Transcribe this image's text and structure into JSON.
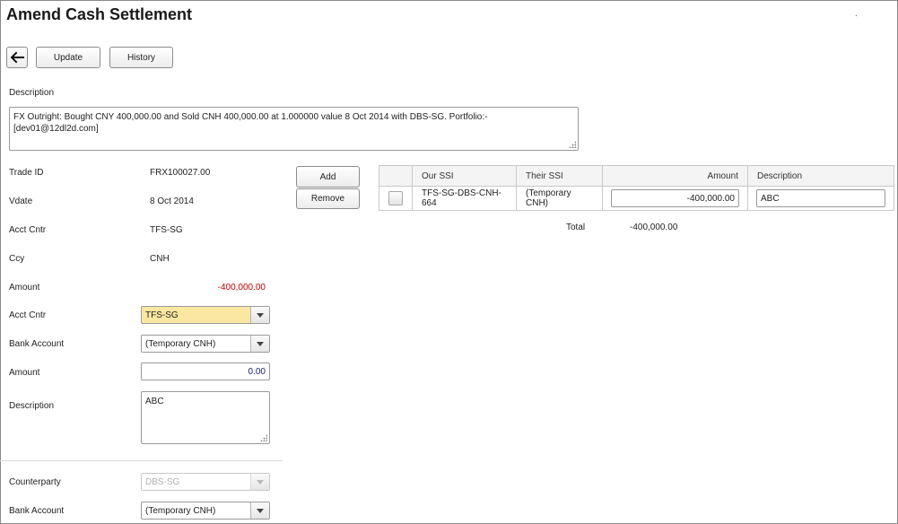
{
  "page": {
    "title": "Amend Cash Settlement",
    "corner_mark": "."
  },
  "toolbar": {
    "back_icon": "arrow-left-icon",
    "update_label": "Update",
    "history_label": "History"
  },
  "description": {
    "label": "Description",
    "value": "FX Outright: Bought CNY 400,000.00 and Sold CNH 400,000.00 at 1.000000 value 8 Oct 2014 with DBS-SG. Portfolio:- [dev01@12dl2d.com]"
  },
  "trade": {
    "trade_id_label": "Trade ID",
    "trade_id": "FRX100027.00",
    "vdate_label": "Vdate",
    "vdate": "8 Oct 2014",
    "acct_cntr_label": "Acct Cntr",
    "acct_cntr": "TFS-SG",
    "ccy_label": "Ccy",
    "ccy": "CNH",
    "amount_label": "Amount",
    "amount": "-400,000.00",
    "amount_color": "#c00000"
  },
  "form": {
    "acct_cntr_label": "Acct Cntr",
    "acct_cntr_value": "TFS-SG",
    "bank_account_label": "Bank Account",
    "bank_account_value": "(Temporary CNH)",
    "amount_label": "Amount",
    "amount_value": "0.00",
    "description_label": "Description",
    "description_value": "ABC",
    "highlight_color": "#fbe7a1"
  },
  "counterparty": {
    "counterparty_label": "Counterparty",
    "counterparty_value": "DBS-SG",
    "bank_account_label": "Bank Account",
    "bank_account_value": "(Temporary CNH)"
  },
  "grid_actions": {
    "add_label": "Add",
    "remove_label": "Remove"
  },
  "grid": {
    "columns": [
      "Our SSI",
      "Their SSI",
      "Amount",
      "Description"
    ],
    "rows": [
      {
        "our_ssi": "TFS-SG-DBS-CNH-664",
        "their_ssi": "(Temporary CNH)",
        "amount": "-400,000.00",
        "description": "ABC"
      }
    ],
    "total_label": "Total",
    "total_value": "-400,000.00"
  }
}
